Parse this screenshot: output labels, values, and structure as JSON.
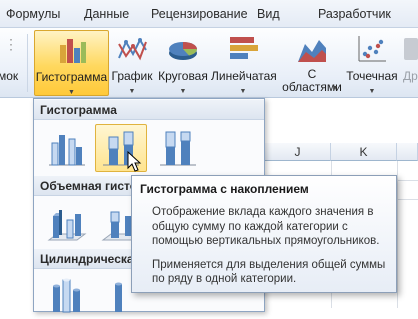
{
  "tabs": [
    "Формулы",
    "Данные",
    "Рецензирование",
    "Вид",
    "Разработчик"
  ],
  "ribbon": {
    "left_fragment": "мок",
    "right_fragment": "Др",
    "buttons": [
      {
        "id": "histogram",
        "label": "Гистограмма",
        "icon": "column-chart-icon"
      },
      {
        "id": "line",
        "label": "График",
        "icon": "line-chart-icon"
      },
      {
        "id": "pie",
        "label": "Круговая",
        "icon": "pie-chart-icon"
      },
      {
        "id": "bar",
        "label": "Линейчатая",
        "icon": "bar-chart-icon"
      },
      {
        "id": "area",
        "label": "С\nобластями",
        "icon": "area-chart-icon"
      },
      {
        "id": "scatter",
        "label": "Точечная",
        "icon": "scatter-chart-icon"
      }
    ]
  },
  "sheet": {
    "columns": [
      "J",
      "K"
    ]
  },
  "gallery": {
    "sections": [
      "Гистограмма",
      "Объемная гисто",
      "Цилиндрическа"
    ]
  },
  "tooltip": {
    "title": "Гистограмма с накоплением",
    "body": "Отображение вклада каждого значения в общую сумму по каждой категории с помощью вертикальных прямоугольников.",
    "note": "Применяется для выделения общей суммы по ряду в одной категории."
  },
  "colors": {
    "accent": "#ffd85e",
    "bar_blue": "#4f81bd",
    "bar_light": "#c6d9f1"
  }
}
